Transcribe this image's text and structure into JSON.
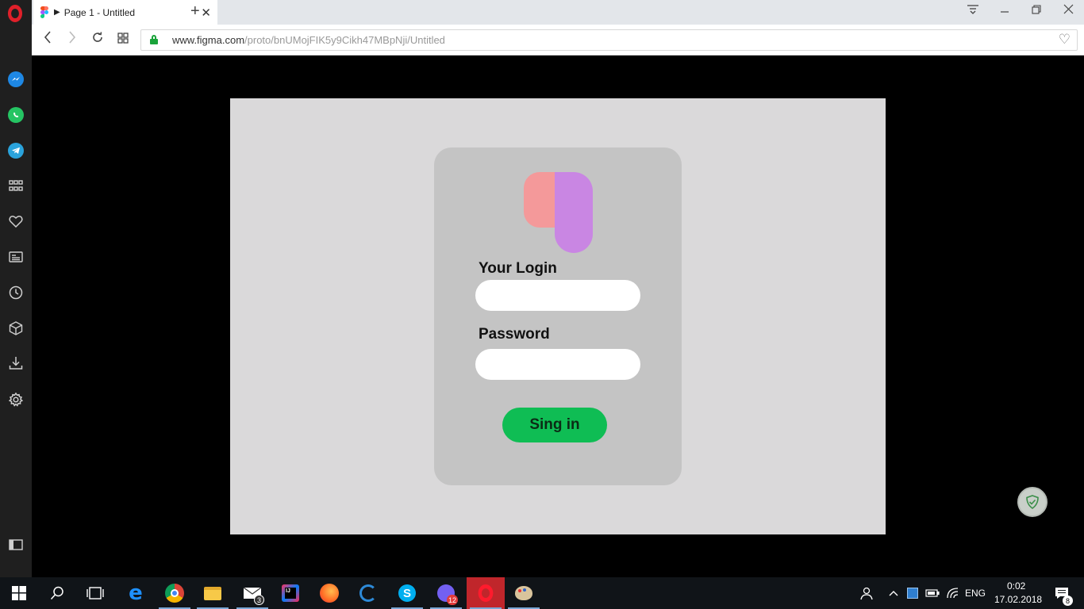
{
  "browser": {
    "tab": {
      "title": "Page 1 - Untitled",
      "play_glyph": "▶",
      "close_glyph": "✕"
    },
    "new_tab_glyph": "+",
    "url": {
      "host": "www.figma.com",
      "path": "/proto/bnUMojFIK5y9Cikh47MBpNji/Untitled"
    },
    "nav": {
      "back": "‹",
      "forward": "›",
      "reload": "↻"
    },
    "window": {
      "minimize": "—",
      "restore": "❐",
      "close": "✕",
      "menu": "≡"
    },
    "heart_glyph": "♡"
  },
  "sidebar": {
    "items": [
      "messenger-icon",
      "whatsapp-icon",
      "telegram-icon",
      "speed-dial-icon",
      "bookmarks-icon",
      "news-icon",
      "history-icon",
      "extensions-icon",
      "downloads-icon",
      "settings-icon",
      "sidebar-toggle-icon"
    ]
  },
  "login": {
    "login_label": "Your Login",
    "password_label": "Password",
    "login_value": "",
    "password_value": "",
    "button_label": "Sing in"
  },
  "colors": {
    "card": "#c4c4c4",
    "frame": "#dad9da",
    "button": "#0fbd54",
    "logo_pink": "#f4999a",
    "logo_purple": "#c986e3"
  },
  "taskbar": {
    "mail_badge": "3",
    "viber_badge": "12",
    "notifications_badge": "8",
    "language": "ENG",
    "time": "0:02",
    "date": "17.02.2018"
  }
}
